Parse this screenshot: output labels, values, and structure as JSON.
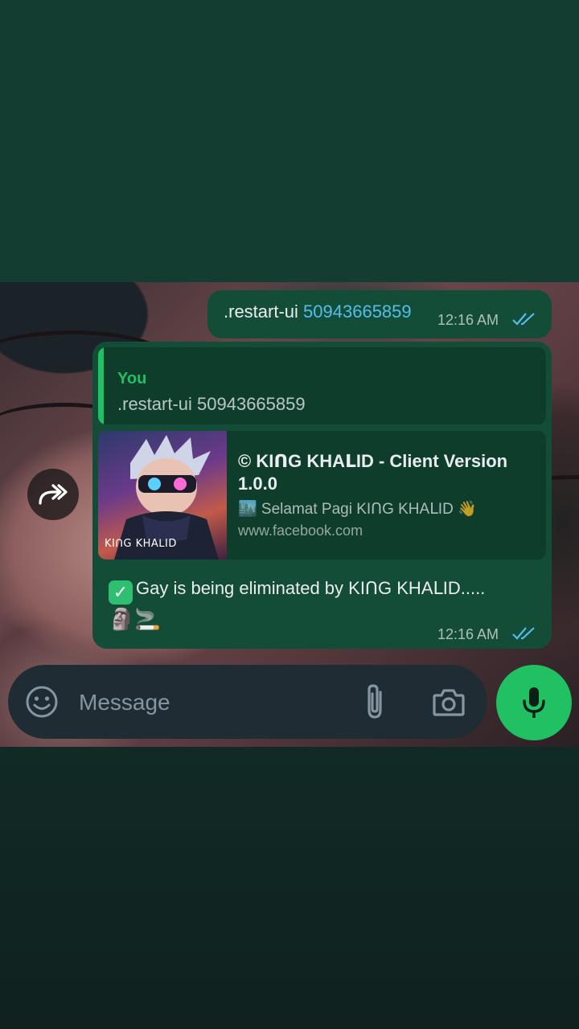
{
  "messages": [
    {
      "command": ".restart-ui",
      "link": "50943665859",
      "time": "12:16 AM"
    },
    {
      "quote": {
        "author": "You",
        "text": ".restart-ui 50943665859"
      },
      "preview": {
        "thumb_caption": "KIᑎG KHAᒪID",
        "title": "© KIᑎG KHAᒪID - Client Version 1.0.0",
        "description": "🏙️ Selamat Pagi KIᑎG KHAᒪID 👋",
        "site": "www.facebook.com"
      },
      "body_emoji": "✓",
      "body": "Gay is being eliminated by KIᑎG KHAᒪID.....",
      "trailing_emojis": "🗿🚬",
      "time": "12:16 AM"
    }
  ],
  "composer": {
    "placeholder": "Message"
  },
  "icons": {
    "forward": "forward-icon",
    "emoji": "emoji-icon",
    "attach": "paperclip-icon",
    "camera": "camera-icon",
    "mic": "microphone-icon",
    "read_receipt": "double-check-icon"
  },
  "colors": {
    "bubble": "#144d37",
    "accent_green": "#21c063",
    "link_blue": "#53bdeb",
    "input_bar": "#1f2c33"
  }
}
